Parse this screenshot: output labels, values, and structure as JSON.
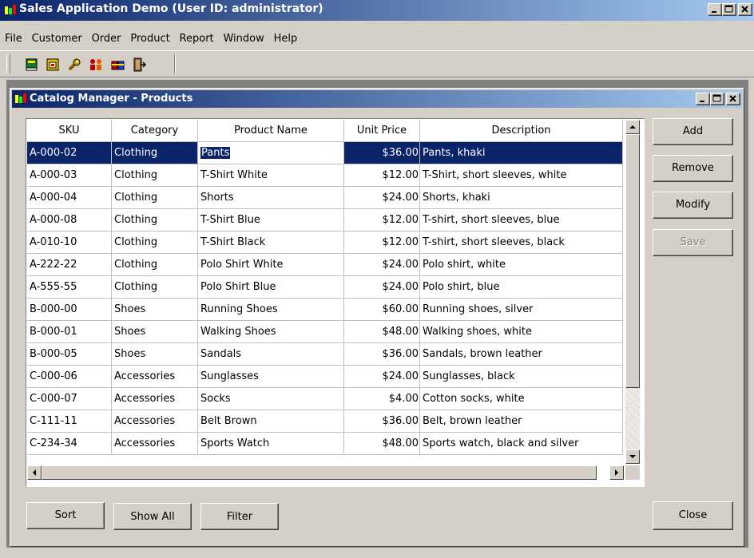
{
  "app": {
    "title": "Sales Application Demo (User ID: administrator)"
  },
  "menu": [
    "File",
    "Customer",
    "Order",
    "Product",
    "Report",
    "Window",
    "Help"
  ],
  "toolbar": {
    "icons": [
      "book-icon",
      "calendar-icon",
      "wrench-icon",
      "people-icon",
      "gift-icon",
      "exit-door-icon"
    ]
  },
  "child": {
    "title": "Catalog Manager - Products"
  },
  "grid": {
    "columns": [
      "SKU",
      "Category",
      "Product Name",
      "Unit Price",
      "Description"
    ],
    "selected_row": 0,
    "editing_cell": "Product Name",
    "rows": [
      [
        "A-000-02",
        "Clothing",
        "Pants",
        "$36.00",
        "Pants, khaki"
      ],
      [
        "A-000-03",
        "Clothing",
        "T-Shirt White",
        "$12.00",
        "T-Shirt, short sleeves, white"
      ],
      [
        "A-000-04",
        "Clothing",
        "Shorts",
        "$24.00",
        "Shorts, khaki"
      ],
      [
        "A-000-08",
        "Clothing",
        "T-Shirt Blue",
        "$12.00",
        "T-shirt, short sleeves, blue"
      ],
      [
        "A-010-10",
        "Clothing",
        "T-Shirt Black",
        "$12.00",
        "T-shirt, short sleeves, black"
      ],
      [
        "A-222-22",
        "Clothing",
        "Polo Shirt White",
        "$24.00",
        "Polo shirt, white"
      ],
      [
        "A-555-55",
        "Clothing",
        "Polo Shirt Blue",
        "$24.00",
        "Polo shirt, blue"
      ],
      [
        "B-000-00",
        "Shoes",
        "Running Shoes",
        "$60.00",
        "Running shoes, silver"
      ],
      [
        "B-000-01",
        "Shoes",
        "Walking Shoes",
        "$48.00",
        "Walking shoes, white"
      ],
      [
        "B-000-05",
        "Shoes",
        "Sandals",
        "$36.00",
        "Sandals, brown leather"
      ],
      [
        "C-000-06",
        "Accessories",
        "Sunglasses",
        "$24.00",
        "Sunglasses, black"
      ],
      [
        "C-000-07",
        "Accessories",
        "Socks",
        "$4.00",
        "Cotton socks, white"
      ],
      [
        "C-111-11",
        "Accessories",
        "Belt Brown",
        "$36.00",
        "Belt, brown leather"
      ],
      [
        "C-234-34",
        "Accessories",
        "Sports Watch",
        "$48.00",
        "Sports watch, black and silver"
      ]
    ]
  },
  "side_buttons": {
    "add": "Add",
    "remove": "Remove",
    "modify": "Modify",
    "save": "Save",
    "close": "Close"
  },
  "bottom_buttons": {
    "sort": "Sort",
    "show_all": "Show All",
    "filter": "Filter"
  },
  "colors": {
    "title_gradient_start": "#0a246a",
    "title_gradient_end": "#a6caf0",
    "selection": "#0a246a",
    "face": "#d4d0c8"
  }
}
